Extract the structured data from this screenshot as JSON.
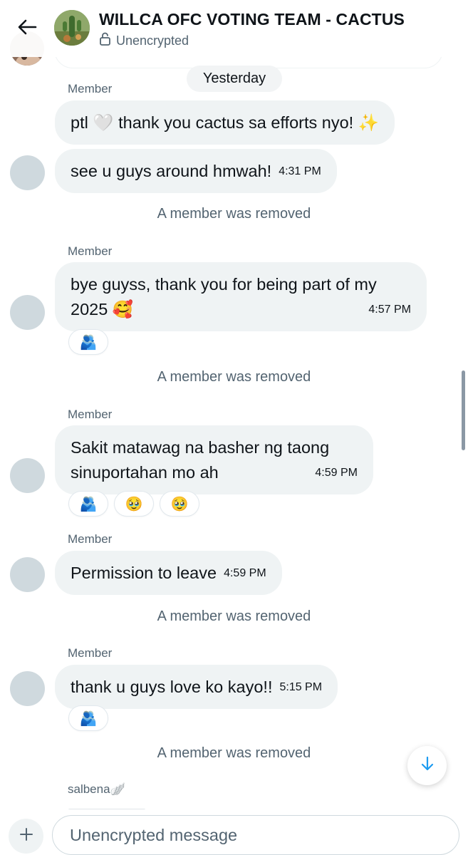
{
  "header": {
    "title": "WILLCA OFC VOTING TEAM - CACTUS",
    "subtitle": "Unencrypted"
  },
  "date_separator": "Yesterday",
  "messages": [
    {
      "sender": "Member",
      "text": "ptl 🤍 thank you cactus sa efforts nyo! ✨",
      "time": ""
    },
    {
      "sender": "",
      "text": "see u guys around hmwah!",
      "time": "4:31 PM"
    },
    {
      "sender": "Member",
      "text": "bye guyss, thank you for being part of my 2025 🥰",
      "time": "4:57 PM"
    },
    {
      "sender": "Member",
      "text": "Sakit matawag na basher ng taong sinuportahan mo ah",
      "time": "4:59 PM"
    },
    {
      "sender": "Member",
      "text": "Permission to leave",
      "time": "4:59 PM"
    },
    {
      "sender": "Member",
      "text": "thank u guys love ko kayo!!",
      "time": "5:15 PM"
    }
  ],
  "reactions": {
    "msg3": [
      "🫂"
    ],
    "msg4": [
      "🫂",
      "🥹",
      "🥹"
    ],
    "msg6": [
      "🫂"
    ]
  },
  "system": {
    "removed_1": "A member was removed",
    "removed_2": "A member was removed",
    "removed_3": "A member was removed",
    "removed_4": "A member was removed"
  },
  "bottom_sender": "salbena🪽",
  "composer": {
    "placeholder": "Unencrypted message"
  },
  "colors": {
    "bubble": "#eff3f4",
    "secondary_text": "#536471",
    "accent": "#1d9bf0"
  }
}
